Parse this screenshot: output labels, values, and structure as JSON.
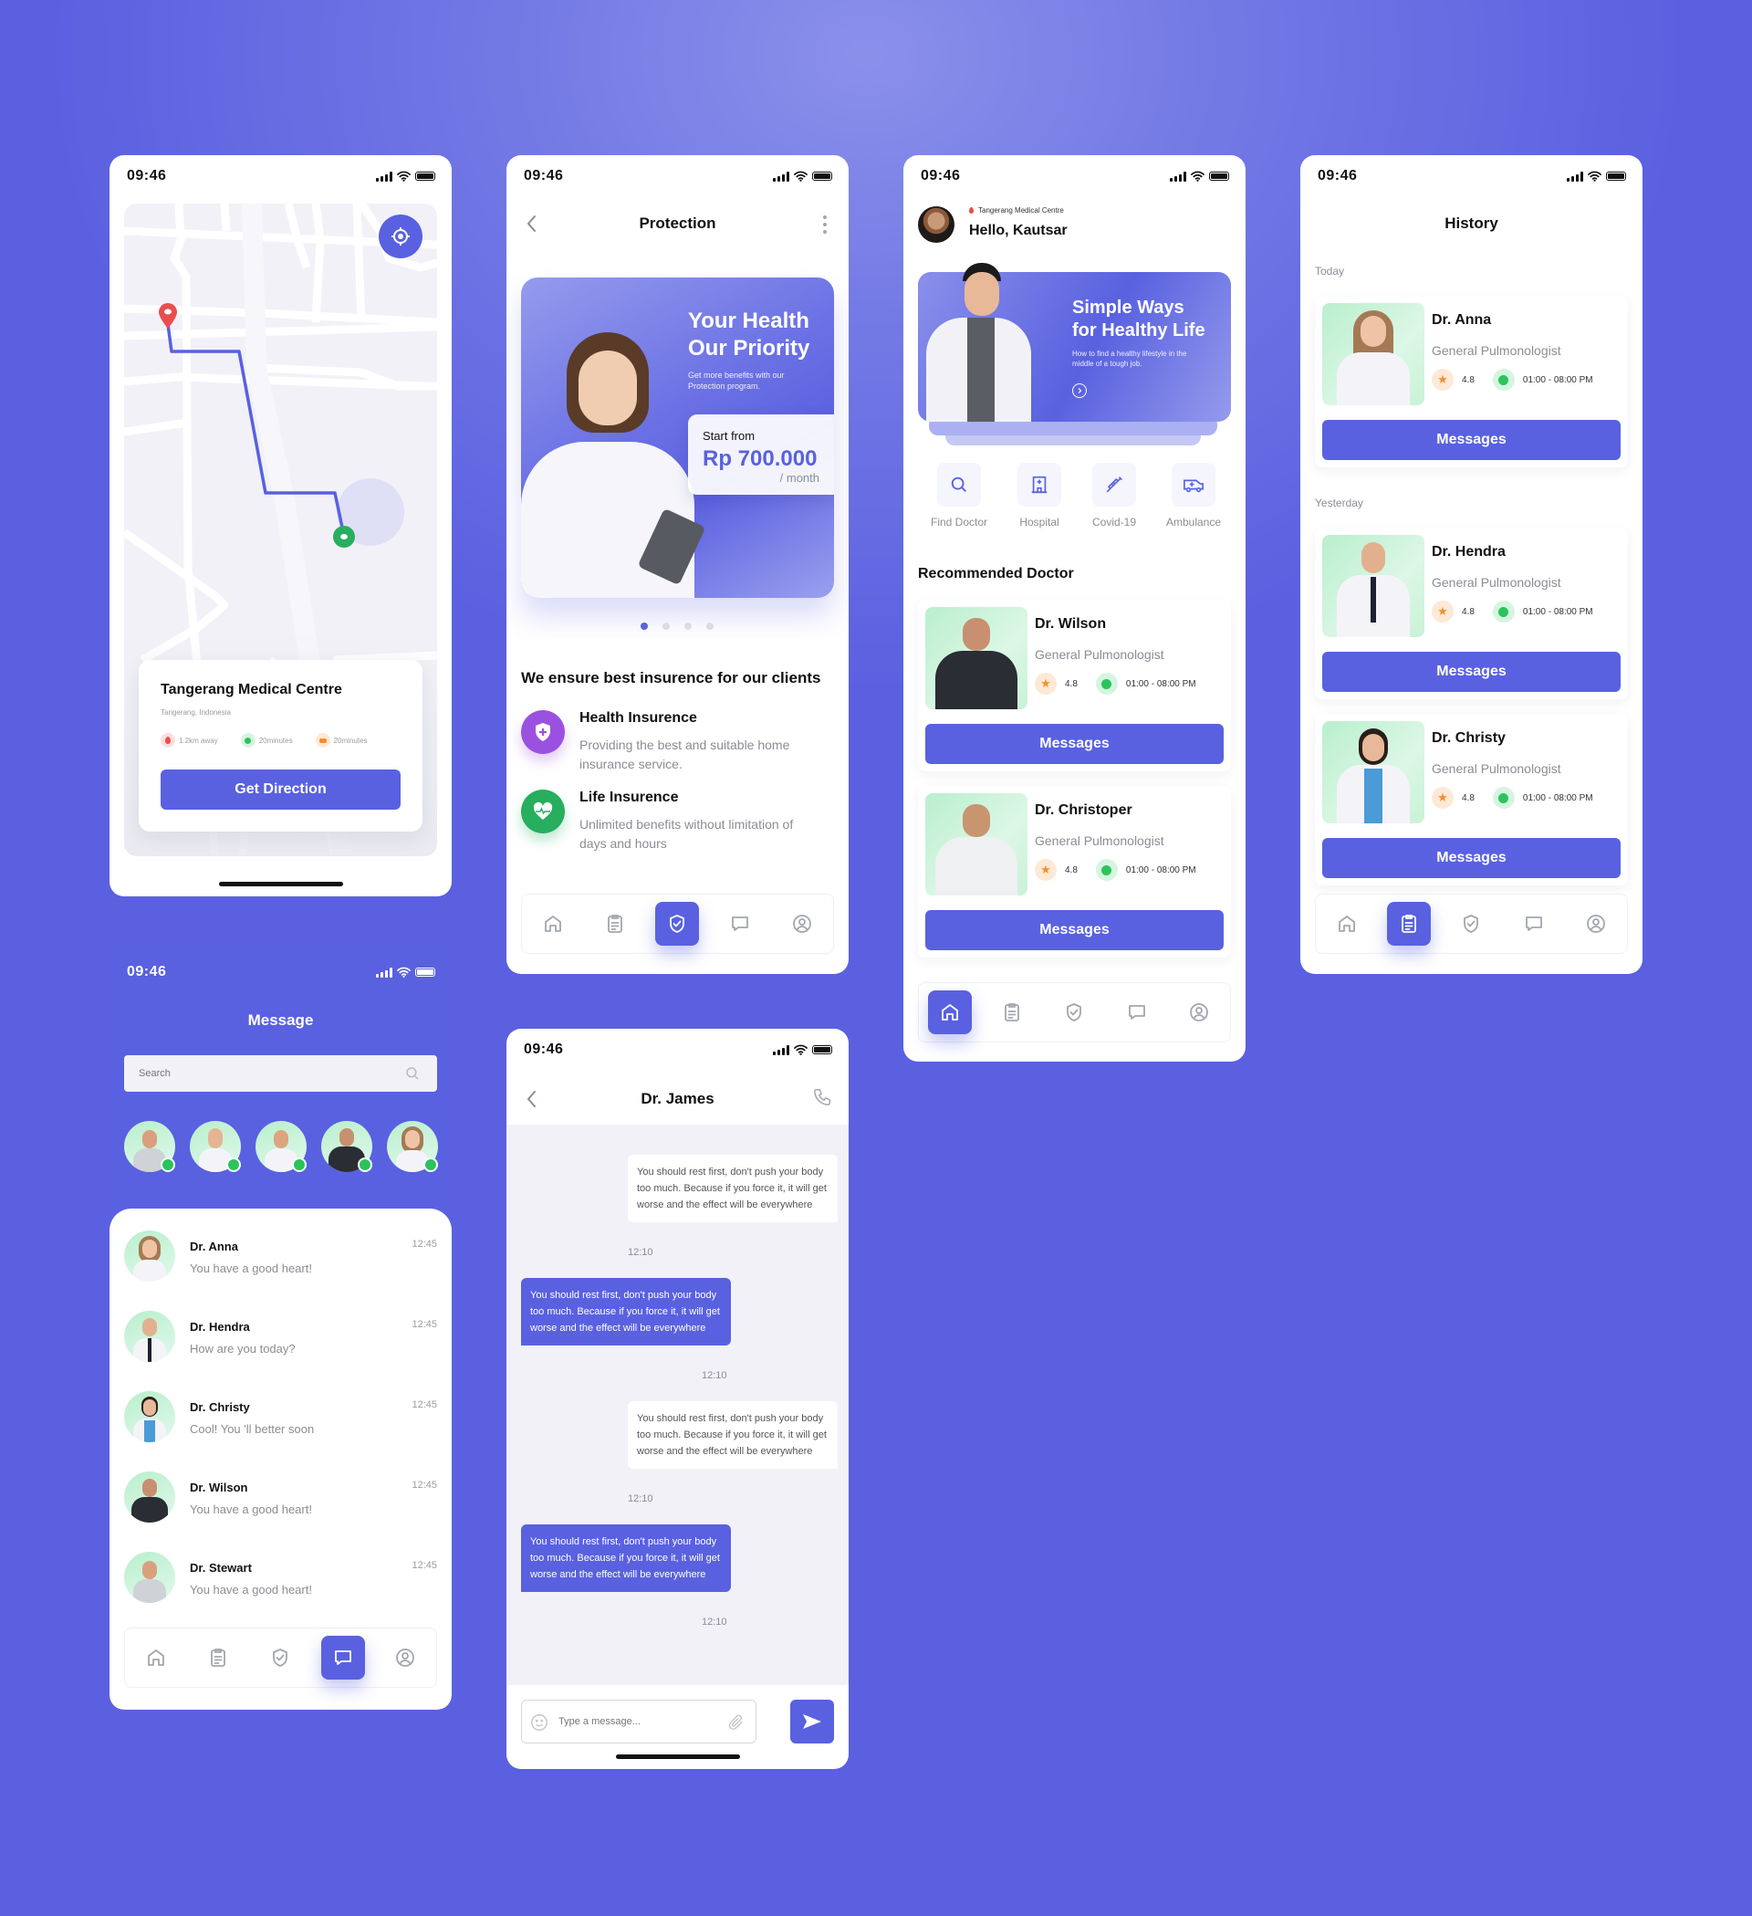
{
  "status_bar": {
    "time": "09:46"
  },
  "colors": {
    "accent": "#5961E0",
    "background": "#5B61E0",
    "green": "#2BC35C",
    "orange": "#F58D2F",
    "red": "#E94E4E",
    "purple": "#9B51E0"
  },
  "map_screen": {
    "locate_button_icon": "crosshair-icon",
    "location_card": {
      "name": "Tangerang Medical Centre",
      "address": "Tangerang, Indonesia",
      "distance": "1.2km away",
      "walk_time": "20minutes",
      "drive_time": "20minutes",
      "cta": "Get Direction"
    }
  },
  "protection_screen": {
    "title": "Protection",
    "banner": {
      "headline_line1": "Your Health",
      "headline_line2": "Our Priority",
      "subtitle": "Get more benefits with our Protection program.",
      "price_label": "Start from",
      "price": "Rp 700.000",
      "price_unit": "/ month"
    },
    "carousel": {
      "count": 4,
      "active_index": 0
    },
    "section_title": "We ensure best insurence for our clients",
    "features": [
      {
        "title": "Health Insurence",
        "description": "Providing the best and suitable home insurance service.",
        "icon": "shield-plus-icon"
      },
      {
        "title": "Life Insurence",
        "description": "Unlimited benefits without limitation of days and hours",
        "icon": "heart-pulse-icon"
      }
    ],
    "active_tab": "protection"
  },
  "home_screen": {
    "location": "Tangerang Medical Centre",
    "greeting": "Hello, Kautsar",
    "banner": {
      "headline_line1": "Simple Ways",
      "headline_line2": "for Healthy Life",
      "subtitle": "How to find a healthy lifestyle in the middle of a tough job."
    },
    "categories": [
      {
        "label": "Find Doctor",
        "icon": "search-icon"
      },
      {
        "label": "Hospital",
        "icon": "hospital-icon"
      },
      {
        "label": "Covid-19",
        "icon": "syringe-icon"
      },
      {
        "label": "Ambulance",
        "icon": "ambulance-icon"
      }
    ],
    "section_title": "Recommended Doctor",
    "doctors": [
      {
        "name": "Dr. Wilson",
        "specialty": "General Pulmonologist",
        "rating": "4.8",
        "hours": "01:00 - 08:00 PM",
        "cta": "Messages"
      },
      {
        "name": "Dr. Christoper",
        "specialty": "General Pulmonologist",
        "rating": "4.8",
        "hours": "01:00 - 08:00 PM",
        "cta": "Messages"
      }
    ],
    "active_tab": "home"
  },
  "history_screen": {
    "title": "History",
    "groups": [
      {
        "label": "Today",
        "doctors": [
          {
            "name": "Dr. Anna",
            "specialty": "General Pulmonologist",
            "rating": "4.8",
            "hours": "01:00 - 08:00 PM",
            "cta": "Messages"
          }
        ]
      },
      {
        "label": "Yesterday",
        "doctors": [
          {
            "name": "Dr. Hendra",
            "specialty": "General Pulmonologist",
            "rating": "4.8",
            "hours": "01:00 - 08:00 PM",
            "cta": "Messages"
          },
          {
            "name": "Dr. Christy",
            "specialty": "General Pulmonologist",
            "rating": "4.8",
            "hours": "01:00 - 08:00 PM",
            "cta": "Messages"
          }
        ]
      }
    ],
    "active_tab": "history"
  },
  "message_screen": {
    "title": "Message",
    "search_placeholder": "Search",
    "online_count": 5,
    "conversations": [
      {
        "name": "Dr. Anna",
        "preview": "You have a good heart!",
        "time": "12:45"
      },
      {
        "name": "Dr. Hendra",
        "preview": "How are you today?",
        "time": "12:45"
      },
      {
        "name": "Dr. Christy",
        "preview": "Cool! You 'll better soon",
        "time": "12:45"
      },
      {
        "name": "Dr. Wilson",
        "preview": "You have a good heart!",
        "time": "12:45"
      },
      {
        "name": "Dr. Stewart",
        "preview": "You have a good heart!",
        "time": "12:45"
      }
    ],
    "active_tab": "messages"
  },
  "chat_screen": {
    "title": "Dr. James",
    "messages": [
      {
        "from": "doctor",
        "text": "You should rest first, don't push your body too much. Because if you force it, it will get worse and the effect will be everywhere",
        "time": "12:10"
      },
      {
        "from": "me",
        "text": "You should rest first, don't push your body too much. Because if you force it, it will get worse and the effect will be everywhere",
        "time": "12:10"
      },
      {
        "from": "doctor",
        "text": "You should rest first, don't push your body too much. Because if you force it, it will get worse and the effect will be everywhere",
        "time": "12:10"
      },
      {
        "from": "me",
        "text": "You should rest first, don't push your body too much. Because if you force it, it will get worse and the effect will be everywhere",
        "time": "12:10"
      }
    ],
    "input_placeholder": "Type a message..."
  }
}
